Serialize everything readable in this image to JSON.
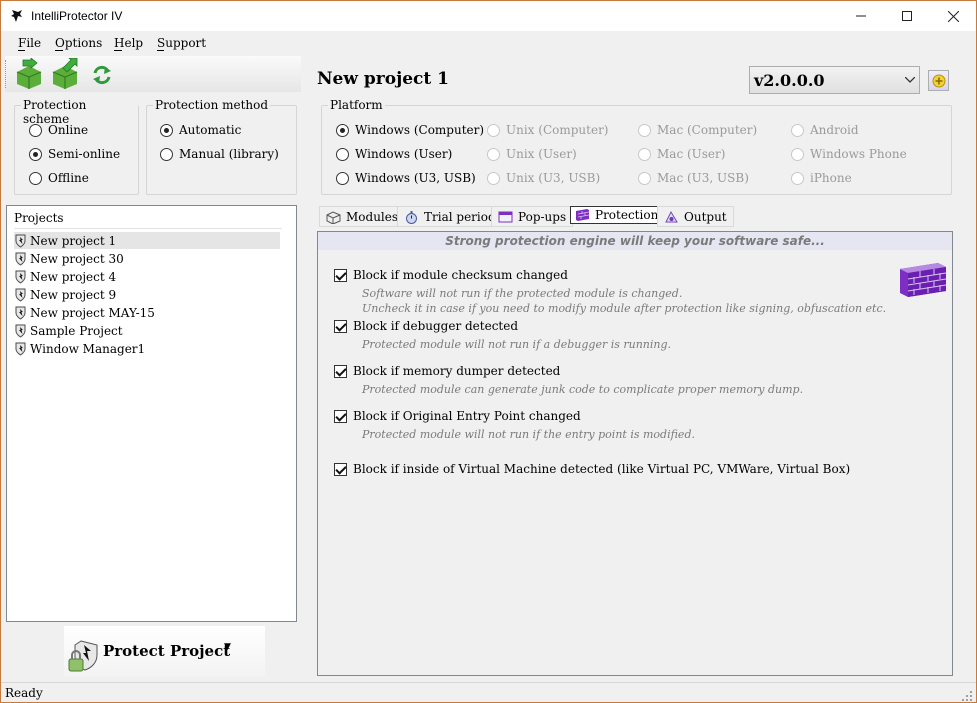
{
  "window": {
    "title": "IntelliProtector IV"
  },
  "menu": [
    "File",
    "Options",
    "Help",
    "Support"
  ],
  "scheme": {
    "title": "Protection scheme",
    "options": [
      {
        "label": "Online",
        "checked": false
      },
      {
        "label": "Semi-online",
        "checked": true
      },
      {
        "label": "Offline",
        "checked": false
      }
    ]
  },
  "method": {
    "title": "Protection method",
    "options": [
      {
        "label": "Automatic",
        "checked": true
      },
      {
        "label": "Manual (library)",
        "checked": false
      }
    ]
  },
  "projects": {
    "title": "Projects",
    "items": [
      "New project 1",
      "New project 30",
      "New project 4",
      "New project 9",
      "New project MAY-15",
      "Sample Project",
      "Window Manager1"
    ],
    "selected": "New project 1"
  },
  "protect_button": {
    "label": "Protect Project"
  },
  "project": {
    "name": "New project 1",
    "version": "v2.0.0.0"
  },
  "platform": {
    "title": "Platform",
    "columns": [
      [
        {
          "label": "Windows (Computer)",
          "checked": true,
          "enabled": true
        },
        {
          "label": "Windows (User)",
          "checked": false,
          "enabled": true
        },
        {
          "label": "Windows (U3, USB)",
          "checked": false,
          "enabled": true
        }
      ],
      [
        {
          "label": "Unix (Computer)",
          "checked": false,
          "enabled": false
        },
        {
          "label": "Unix (User)",
          "checked": false,
          "enabled": false
        },
        {
          "label": "Unix (U3, USB)",
          "checked": false,
          "enabled": false
        }
      ],
      [
        {
          "label": "Mac (Computer)",
          "checked": false,
          "enabled": false
        },
        {
          "label": "Mac (User)",
          "checked": false,
          "enabled": false
        },
        {
          "label": "Mac (U3, USB)",
          "checked": false,
          "enabled": false
        }
      ],
      [
        {
          "label": "Android",
          "checked": false,
          "enabled": false
        },
        {
          "label": "Windows Phone",
          "checked": false,
          "enabled": false
        },
        {
          "label": "iPhone",
          "checked": false,
          "enabled": false
        }
      ]
    ]
  },
  "tabs": [
    {
      "label": "Modules",
      "icon": "modules-icon",
      "active": false
    },
    {
      "label": "Trial period",
      "icon": "stopwatch-icon",
      "active": false
    },
    {
      "label": "Pop-ups",
      "icon": "popup-icon",
      "active": false
    },
    {
      "label": "Protection",
      "icon": "brick-wall-icon",
      "active": true
    },
    {
      "label": "Output",
      "icon": "output-icon",
      "active": false
    }
  ],
  "protection": {
    "banner": "Strong protection engine will keep your software safe...",
    "options": [
      {
        "label": "Block if module checksum changed",
        "checked": true,
        "desc": [
          "Software will not run if the protected module is changed.",
          "Uncheck it in case if you need to modify module after protection like signing, obfuscation etc."
        ]
      },
      {
        "label": "Block if debugger detected",
        "checked": true,
        "desc": [
          "Protected module will not run if a debugger is running."
        ]
      },
      {
        "label": "Block if memory dumper detected",
        "checked": true,
        "desc": [
          "Protected module can generate junk code to complicate proper memory dump."
        ]
      },
      {
        "label": "Block if Original Entry Point changed",
        "checked": true,
        "desc": [
          "Protected module will not run if the entry point is modified."
        ]
      },
      {
        "label": "Block if inside of Virtual Machine detected (like Virtual PC, VMWare, Virtual Box)",
        "checked": true,
        "desc": []
      }
    ]
  },
  "status": {
    "text": "Ready"
  },
  "colors": {
    "accent_purple": "#7d2fc4",
    "window_border": "#c77a3a",
    "banner_bg": "#e6e6f3"
  }
}
